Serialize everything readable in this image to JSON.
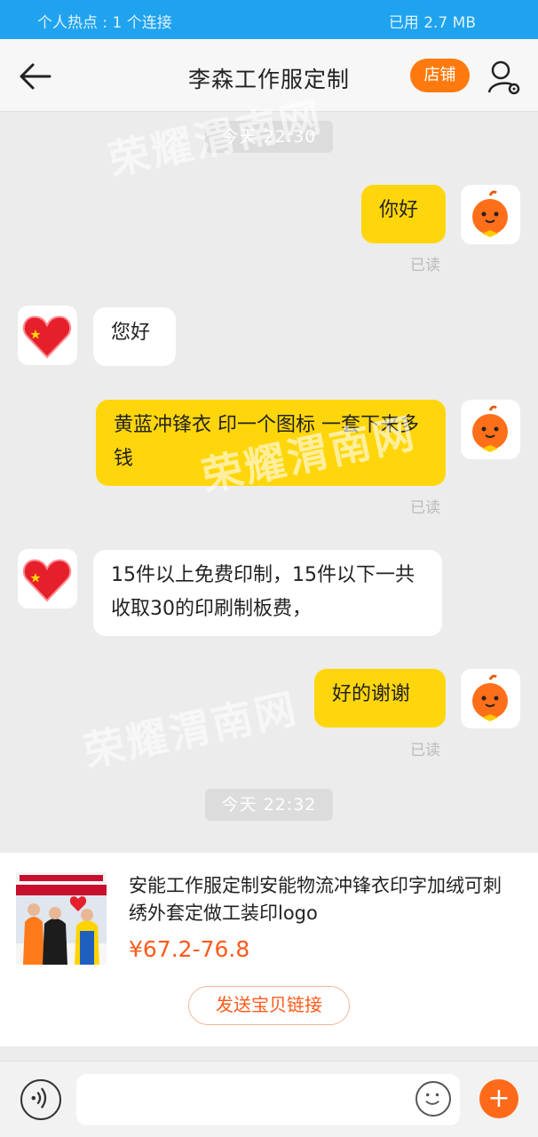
{
  "status_bar": {
    "hotspot": "个人热点 : 1 个连接",
    "data_used": "已用 2.7 MB"
  },
  "header": {
    "title": "李森工作服定制",
    "store_button": "店铺"
  },
  "messages": [
    {
      "type": "time",
      "text": "今天 22:30"
    },
    {
      "type": "me",
      "text": "你好",
      "status": "已读"
    },
    {
      "type": "them",
      "text": "您好"
    },
    {
      "type": "me",
      "text": "黄蓝冲锋衣 印一个图标 一套下来多钱",
      "status": "已读"
    },
    {
      "type": "them",
      "text": "15件以上免费印制，15件以下一共收取30的印刷制板费，"
    },
    {
      "type": "me",
      "text": "好的谢谢",
      "status": "已读"
    },
    {
      "type": "time",
      "text": "今天 22:32"
    }
  ],
  "watermark": "荣耀渭南网",
  "product": {
    "title": "安能工作服定制安能物流冲锋衣印字加绒可刺绣外套定做工装印logo",
    "price": "¥67.2-76.8",
    "send_button": "发送宝贝链接"
  },
  "input_bar": {
    "placeholder": ""
  },
  "colors": {
    "accent": "#ff7a0e",
    "my_bubble": "#ffd60b",
    "status_bar": "#1fa3ef"
  }
}
